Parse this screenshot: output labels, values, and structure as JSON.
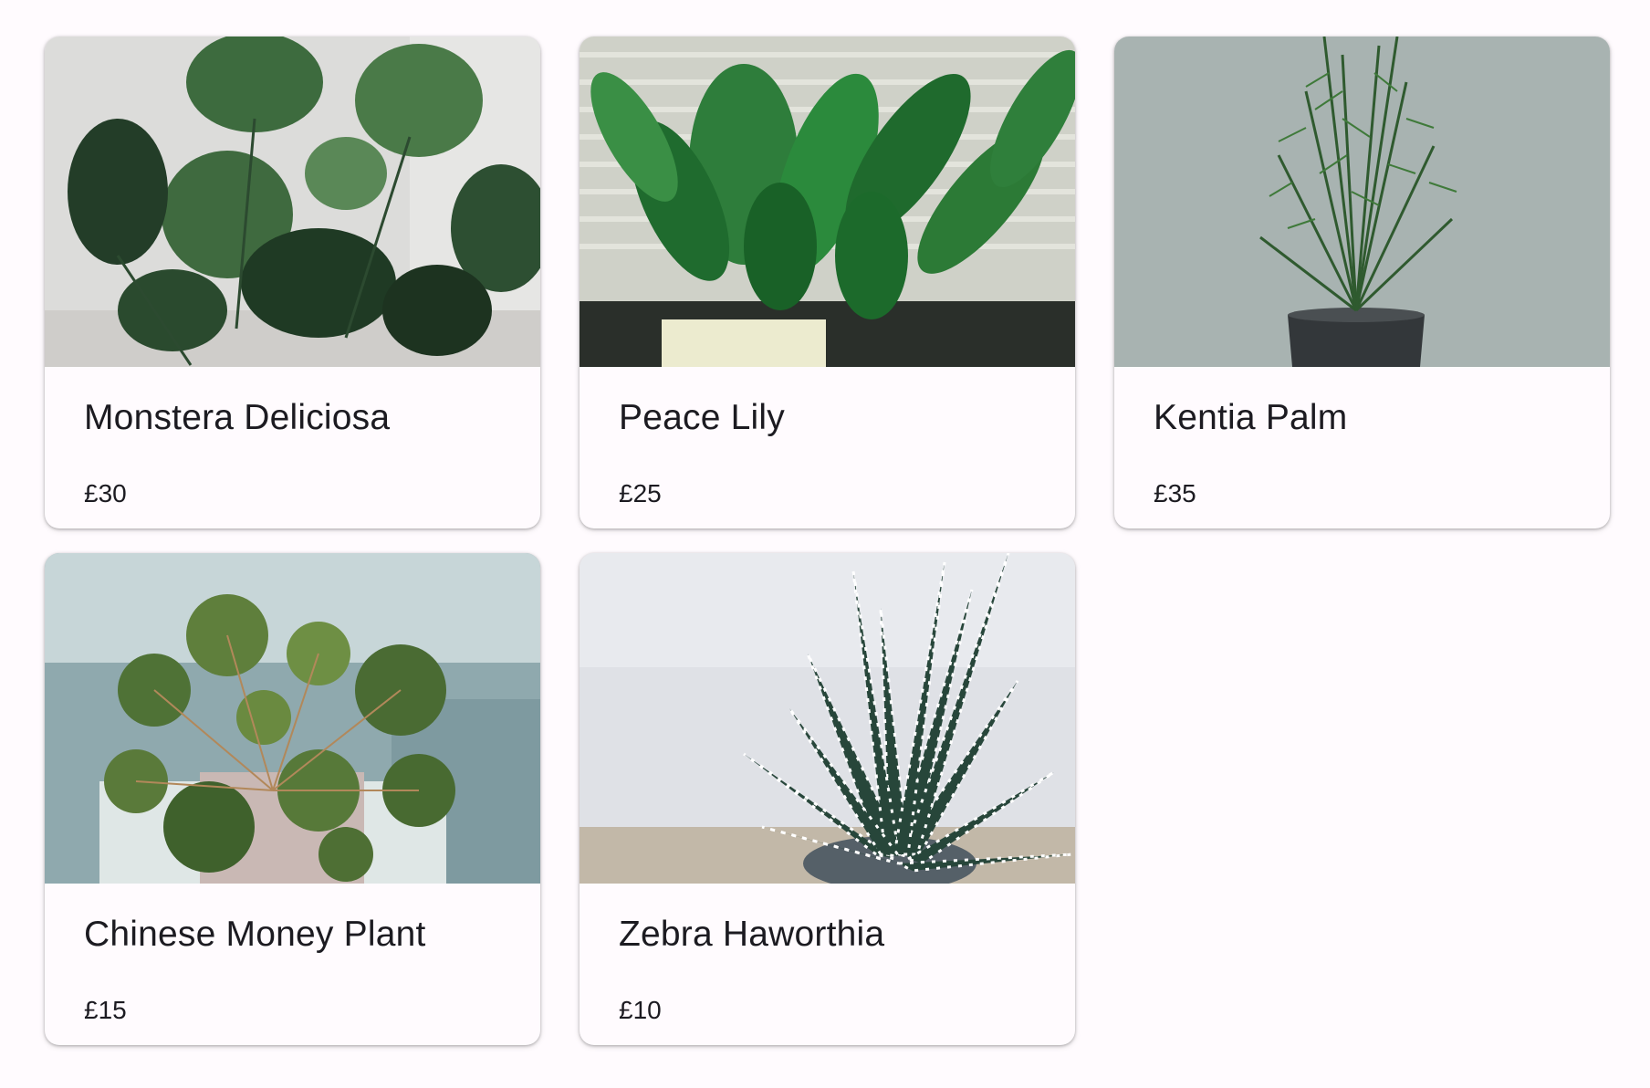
{
  "products": [
    {
      "name": "Monstera Deliciosa",
      "price": "£30",
      "image": "monstera-photo"
    },
    {
      "name": "Peace Lily",
      "price": "£25",
      "image": "peace-lily-photo"
    },
    {
      "name": "Kentia Palm",
      "price": "£35",
      "image": "kentia-palm-photo"
    },
    {
      "name": "Chinese Money Plant",
      "price": "£15",
      "image": "chinese-money-plant-photo"
    },
    {
      "name": "Zebra Haworthia",
      "price": "£10",
      "image": "zebra-haworthia-photo"
    }
  ],
  "colors": {
    "background": "#fffbfe",
    "text": "#1c1b21"
  }
}
